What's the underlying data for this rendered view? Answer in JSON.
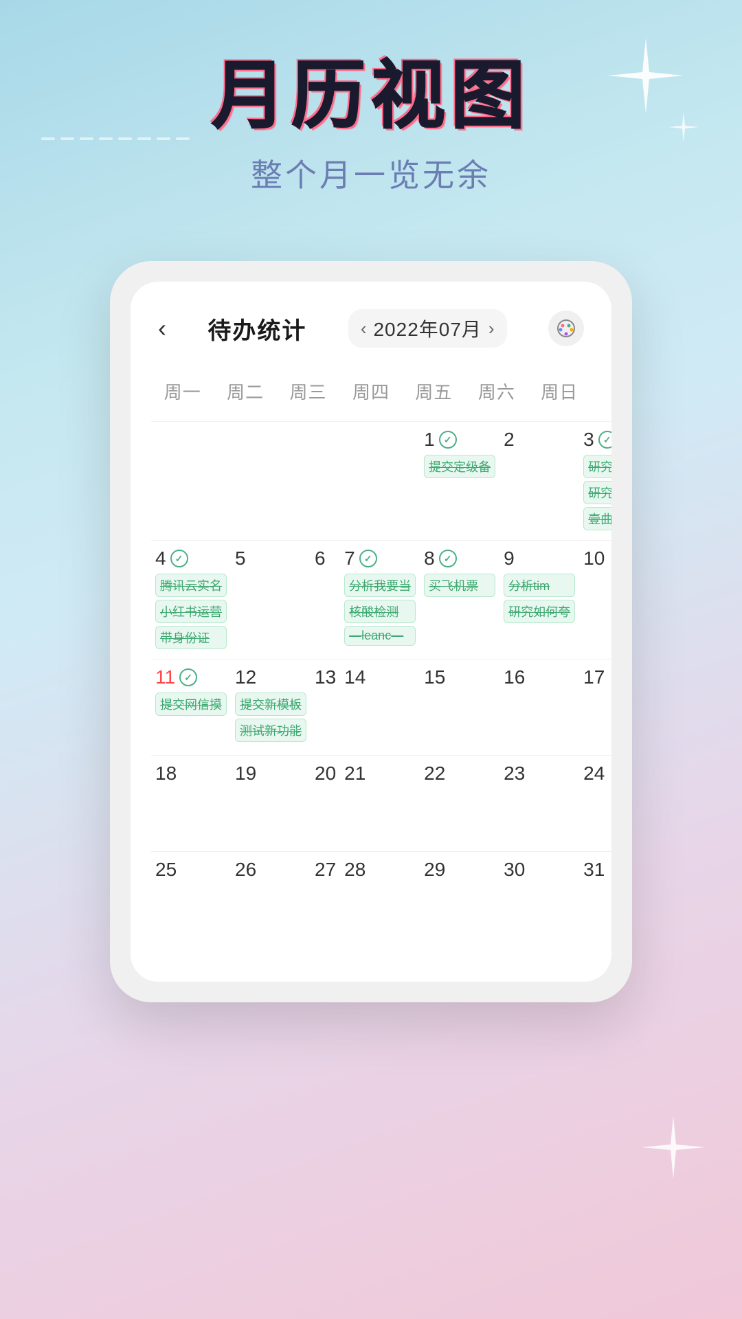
{
  "background": {
    "gradient_start": "#a8d8e8",
    "gradient_end": "#f0c8d8"
  },
  "header": {
    "main_title": "月历视图",
    "sub_title": "整个月一览无余"
  },
  "calendar": {
    "nav_title": "待办统计",
    "month_label": "2022年07月",
    "weekdays": [
      "周一",
      "周二",
      "周三",
      "周四",
      "周五",
      "周六",
      "周日"
    ],
    "weeks": [
      {
        "days": [
          {
            "num": "",
            "empty": true,
            "tasks": [],
            "checked": false
          },
          {
            "num": "",
            "empty": true,
            "tasks": [],
            "checked": false
          },
          {
            "num": "",
            "empty": true,
            "tasks": [],
            "checked": false
          },
          {
            "num": "",
            "empty": true,
            "tasks": [],
            "checked": false
          },
          {
            "num": "1",
            "tasks": [
              "提交定级备"
            ],
            "checked": true
          },
          {
            "num": "2",
            "tasks": [],
            "checked": false
          },
          {
            "num": "3",
            "tasks": [
              "研究如何复",
              "研究如何做",
              "壹曲小板"
            ],
            "checked": true
          }
        ]
      },
      {
        "days": [
          {
            "num": "4",
            "tasks": [
              "腾讯云实名",
              "小红书运营",
              "带身份证"
            ],
            "checked": true
          },
          {
            "num": "5",
            "tasks": [],
            "checked": false
          },
          {
            "num": "6",
            "tasks": [],
            "checked": false
          },
          {
            "num": "7",
            "tasks": [
              "分析我要当",
              "核酸检测",
              "—leanc—"
            ],
            "checked": true
          },
          {
            "num": "8",
            "tasks": [
              "买飞机票"
            ],
            "checked": true
          },
          {
            "num": "9",
            "tasks": [
              "分析tim",
              "研究如何夸"
            ],
            "checked": false
          },
          {
            "num": "10",
            "tasks": [],
            "checked": false
          }
        ]
      },
      {
        "days": [
          {
            "num": "11",
            "tasks": [
              "提交网信摸"
            ],
            "checked": true,
            "today": true
          },
          {
            "num": "12",
            "tasks": [
              "提交新模板",
              "测试新功能"
            ],
            "checked": false
          },
          {
            "num": "13",
            "tasks": [],
            "checked": false
          },
          {
            "num": "14",
            "tasks": [],
            "checked": false
          },
          {
            "num": "15",
            "tasks": [],
            "checked": false
          },
          {
            "num": "16",
            "tasks": [],
            "checked": false
          },
          {
            "num": "17",
            "tasks": [],
            "checked": false
          }
        ]
      },
      {
        "days": [
          {
            "num": "18",
            "tasks": [],
            "checked": false
          },
          {
            "num": "19",
            "tasks": [],
            "checked": false
          },
          {
            "num": "20",
            "tasks": [],
            "checked": false
          },
          {
            "num": "21",
            "tasks": [],
            "checked": false
          },
          {
            "num": "22",
            "tasks": [],
            "checked": false
          },
          {
            "num": "23",
            "tasks": [],
            "checked": false
          },
          {
            "num": "24",
            "tasks": [],
            "checked": false
          }
        ]
      },
      {
        "days": [
          {
            "num": "25",
            "tasks": [],
            "checked": false
          },
          {
            "num": "26",
            "tasks": [],
            "checked": false
          },
          {
            "num": "27",
            "tasks": [],
            "checked": false
          },
          {
            "num": "28",
            "tasks": [],
            "checked": false
          },
          {
            "num": "29",
            "tasks": [],
            "checked": false
          },
          {
            "num": "30",
            "tasks": [],
            "checked": false
          },
          {
            "num": "31",
            "tasks": [],
            "checked": false
          }
        ]
      }
    ]
  }
}
